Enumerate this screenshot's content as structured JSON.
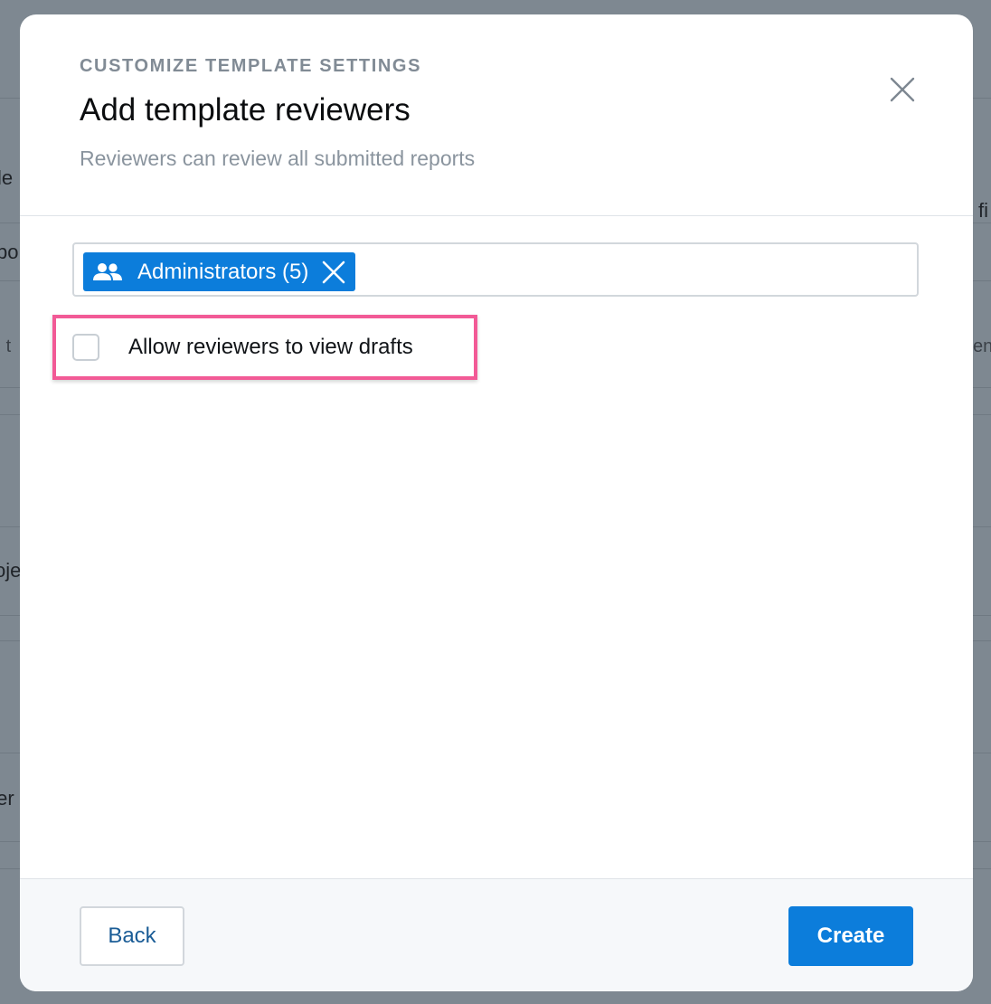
{
  "background": {
    "fragments": [
      "itle",
      "po",
      "d t",
      "oje",
      "ter",
      "fi",
      "en"
    ]
  },
  "modal": {
    "eyebrow": "CUSTOMIZE TEMPLATE SETTINGS",
    "title": "Add template reviewers",
    "subtitle": "Reviewers can review all submitted reports",
    "close_icon": "close-icon"
  },
  "reviewers": {
    "chips": [
      {
        "label": "Administrators (5)",
        "icon": "group-icon",
        "remove_icon": "close-icon"
      }
    ]
  },
  "options": {
    "allow_drafts_label": "Allow reviewers to view drafts",
    "allow_drafts_checked": false
  },
  "footer": {
    "back_label": "Back",
    "create_label": "Create"
  },
  "colors": {
    "primary": "#0c7ddb",
    "highlight": "#f25a96",
    "overlay": "#7e8891"
  }
}
